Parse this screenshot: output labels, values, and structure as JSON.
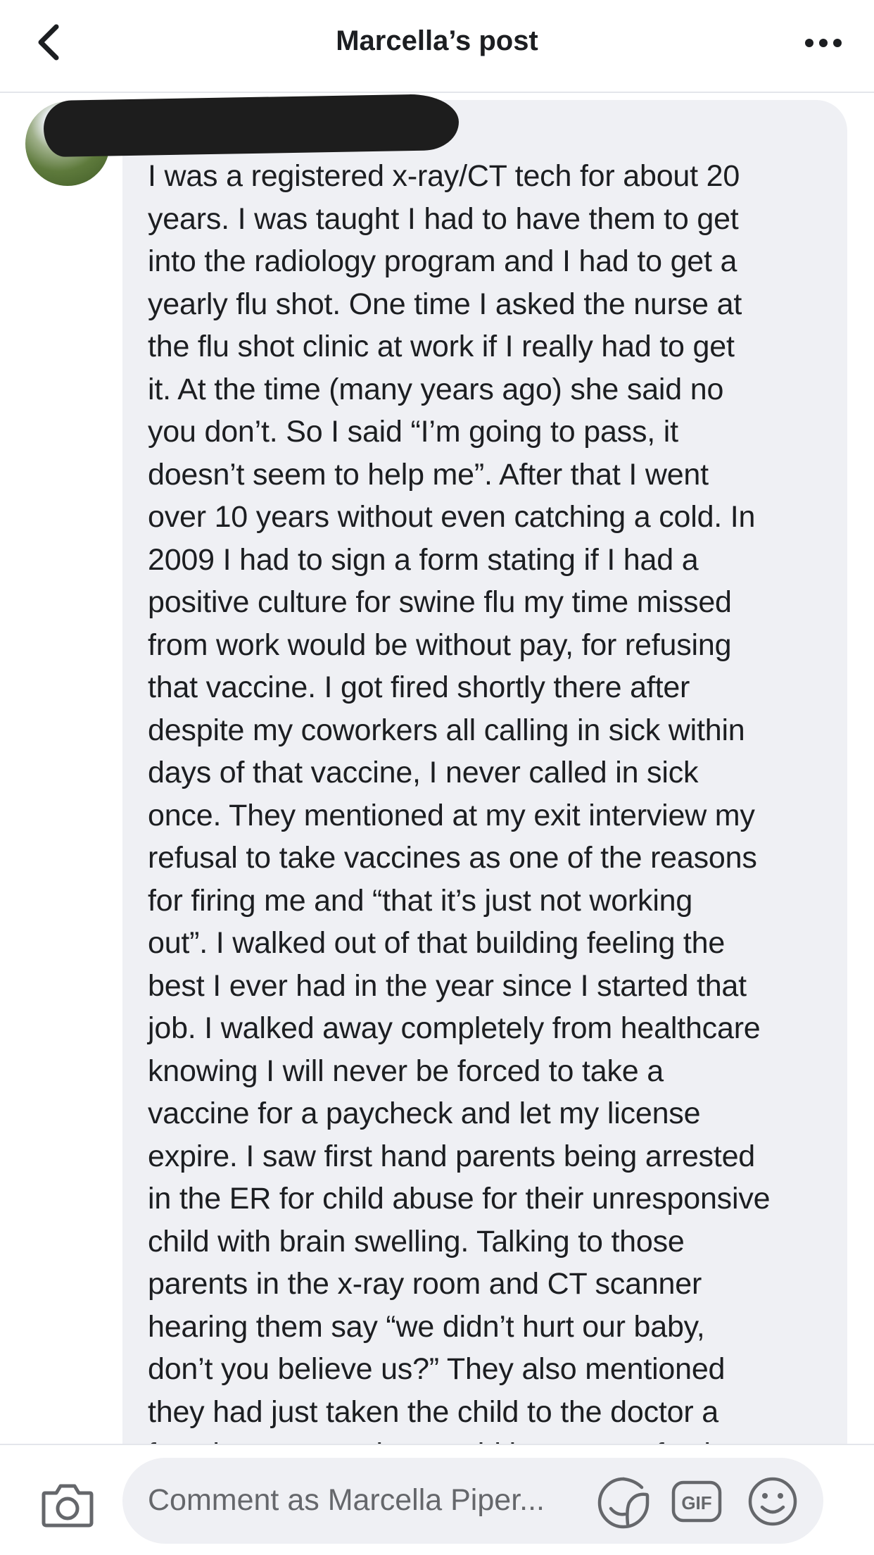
{
  "header": {
    "title": "Marcella’s post",
    "back_icon": "chevron-left-icon",
    "more_icon": "more-horizontal-icon"
  },
  "comment": {
    "author_redacted": true,
    "lines": [
      "I was a registered x-ray/CT tech for about 20",
      "years. I was taught I had to have them to get",
      "into the radiology program and I had to get a",
      "yearly flu shot. One time I asked the nurse at",
      "the flu shot clinic at work if I really had to get",
      "it. At the time (many years ago) she said no",
      "you don’t. So I said “I’m going to pass, it",
      "doesn’t seem to help me”. After that I went",
      "over 10 years without even catching a cold. In",
      "2009 I had to sign a form stating if I had a",
      "positive culture for swine flu my time missed",
      "from work would be without pay, for refusing",
      "that vaccine. I got fired shortly there after",
      "despite my coworkers all calling in sick within",
      "days of that vaccine, I never called in sick",
      "once. They mentioned at my exit interview my",
      "refusal to take vaccines as one of the reasons",
      "for firing me and “that it’s just not working",
      "out”. I walked out of that building feeling the",
      "best I ever had in the year since I started that",
      "job. I walked away completely from healthcare",
      "knowing I will never be forced to take a",
      "vaccine for a paycheck and let my license",
      "expire. I saw first hand parents being arrested",
      "in the ER for child abuse for their unresponsive",
      "child with brain swelling. Talking to those",
      "parents in the x-ray room and CT scanner",
      "hearing them say “we didn’t hurt our baby,",
      "don’t you believe us?” They also mentioned",
      "they had just taken the child to the doctor a",
      "few days ago and was told he was perfectly"
    ]
  },
  "footer": {
    "comment_placeholder": "Comment as Marcella Piper...",
    "gif_label": "GIF",
    "camera_icon": "camera-icon",
    "sticker_icon": "sticker-icon",
    "emoji_icon": "emoji-icon"
  },
  "colors": {
    "bubble": "#eff0f4",
    "text": "#1c1e21",
    "muted": "#65676b"
  }
}
